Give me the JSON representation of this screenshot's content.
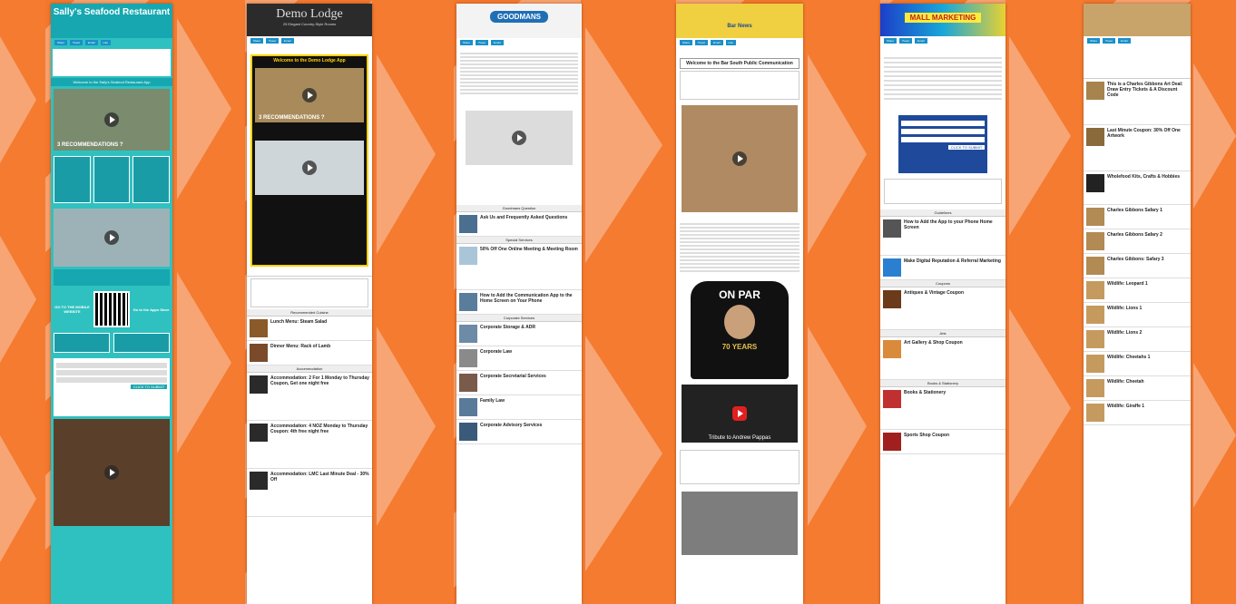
{
  "panels": {
    "sallys": {
      "header": "Sally's Seafood Restaurant",
      "intro": "Welcome to the Sally's Seafood Restaurant App",
      "video1": "3 RECOMMENDATIONS ?",
      "qr_left": "GO TO THE MOBILE WEBSITE",
      "qr_right": "Go to the Apps Store",
      "submit": "CLICK TO SUBMIT"
    },
    "demo_lodge": {
      "header": "Demo Lodge",
      "subheader": "25 Elegant Country-Style Rooms",
      "welcome": "Welcome to the Demo Lodge App",
      "video1": "3 RECOMMENDATIONS ?",
      "listings": [
        {
          "title": "Lunch Menu: Steam Salad"
        },
        {
          "title": "Dinner Menu: Rack of Lamb"
        },
        {
          "title": "Accommodation: 2 For 1 Monday to Thursday Coupon, Get one night free"
        },
        {
          "title": "Accommodation: 4 NOZ Monday to Thursday Coupon: 4th free night free"
        },
        {
          "title": "Accommodation: LMC Last Minute Deal - 30% Off"
        }
      ]
    },
    "goodmans": {
      "header": "GOODMANS",
      "sections": [
        "Goodmans Question",
        "Special Services",
        "Corporate Services"
      ],
      "listings": [
        {
          "title": "Ask Us and Frequently Asked Questions"
        },
        {
          "title": "50% Off One Online Meeting & Meeting Room"
        },
        {
          "title": "How to Add the Communication App to the Home Screen on Your Phone"
        },
        {
          "title": "Corporate Storage & ADR"
        },
        {
          "title": "Corporate Law"
        },
        {
          "title": "Corporate Secretarial Services"
        },
        {
          "title": "Family Law"
        },
        {
          "title": "Corporate Advisory Services"
        }
      ]
    },
    "bar_news": {
      "header": "Bar News",
      "welcome": "Welcome to the Bar South Public Communication",
      "shirt_top": "ON PAR",
      "shirt_bottom": "70 YEARS",
      "video_caption": "Tribute to Andrew Pappas"
    },
    "mall": {
      "header": "MALL MARKETING",
      "sections": [
        "Guidelines",
        "Coupons",
        "Arts",
        "Books & Stationery"
      ],
      "submit": "CLICK TO SUBMIT",
      "listings": [
        {
          "title": "How to Add the App to your Phone Home Screen"
        },
        {
          "title": "Make Digital Reputation & Referral Marketing"
        },
        {
          "title": "Antiques & Vintage Coupon"
        },
        {
          "title": "Art Gallery & Shop Coupon"
        },
        {
          "title": "Books & Stationery"
        },
        {
          "title": "Sports Shop Coupon"
        }
      ]
    },
    "gallery": {
      "listings": [
        {
          "title": "This is a Charles Gibbons Art Deal: Draw Entry Tickets & A Discount Code"
        },
        {
          "title": "Last Minute Coupon: 30% Off One Artwork"
        },
        {
          "title": "Wholefood Kits, Crafts & Hobbies"
        },
        {
          "title": "Charles Gibbons Safary 1"
        },
        {
          "title": "Charles Gibbons Safary 2"
        },
        {
          "title": "Charles Gibbons: Safary 3"
        },
        {
          "title": "Wildlife: Leopard 1"
        },
        {
          "title": "Wildlife: Lions 1"
        },
        {
          "title": "Wildlife: Lions 2"
        },
        {
          "title": "Wildlife: Cheetahs 1"
        },
        {
          "title": "Wildlife: Cheetah"
        },
        {
          "title": "Wildlife: Giraffe 1"
        }
      ]
    }
  }
}
